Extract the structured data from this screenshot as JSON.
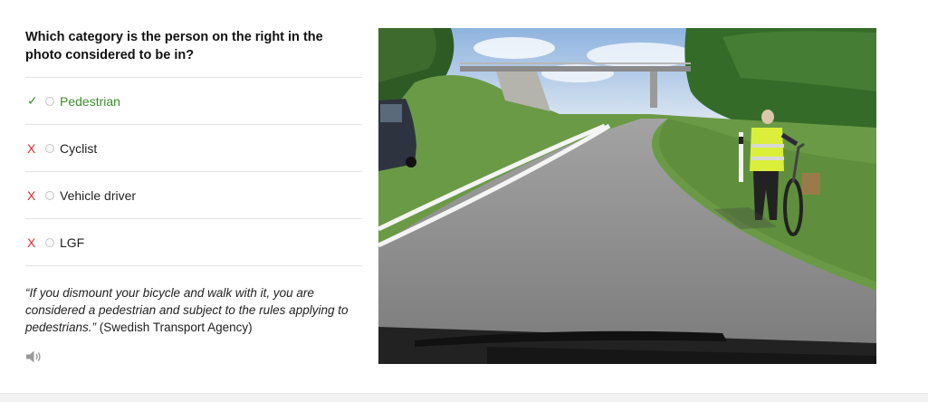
{
  "question": {
    "text": "Which category is the person on the right in the photo considered to be in?"
  },
  "options": [
    {
      "label": "Pedestrian",
      "status": "correct",
      "mark": "✓"
    },
    {
      "label": "Cyclist",
      "status": "incorrect",
      "mark": "X"
    },
    {
      "label": "Vehicle driver",
      "status": "incorrect",
      "mark": "X"
    },
    {
      "label": "LGF",
      "status": "incorrect",
      "mark": "X"
    }
  ],
  "explanation": {
    "quote": "“If you dismount your bicycle and walk with it, you are considered a pedestrian and subject to the rules applying to pedestrians.”",
    "source": " (Swedish Transport Agency)"
  },
  "icons": {
    "correct": "checkmark-icon",
    "incorrect": "x-mark-icon",
    "audio": "speaker-icon"
  },
  "colors": {
    "correct": "#3e8e2e",
    "incorrect": "#e02a2a"
  }
}
